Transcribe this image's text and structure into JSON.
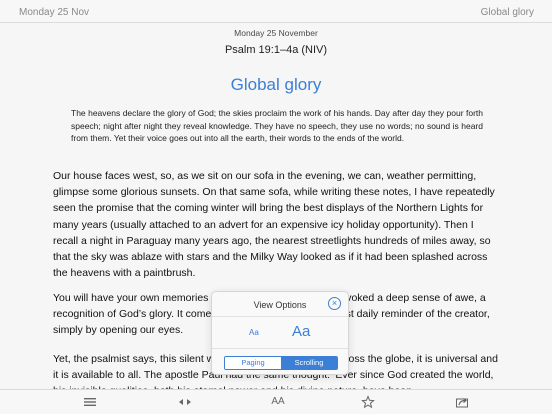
{
  "topbar": {
    "date_label": "Monday 25 Nov",
    "right_label": "Global glory"
  },
  "reading": {
    "date": "Monday 25 November",
    "reference": "Psalm 19:1–4a (NIV)",
    "title": "Global glory",
    "scripture": "The heavens declare the glory of God; the skies proclaim the work of his hands. Day after day they pour forth speech; night after night they reveal knowledge. They have no speech, they use no words; no sound is heard from them. Yet their voice goes out into all the earth, their words to the ends of the world.",
    "paragraphs": [
      "Our house faces west, so, as we sit on our sofa in the evening, we can, weather permitting, glimpse some glorious sunsets. On that same sofa, while writing these notes, I have repeatedly seen the promise that the coming winter will bring the best displays of the Northern Lights for many years (usually attached to an advert for an expensive icy holiday opportunity). Then I recall a night in Paraguay many years ago, the nearest streetlights hundreds of miles away, so that the sky was ablaze with stars and the Milky Way looked as if it had been splashed across the heavens with a paintbrush.",
      "You will have your own memories of when the heavens has provoked a deep sense of awe, a recognition of God’s glory. It comes to us, but it can be an almost daily reminder of the creator, simply by opening our eyes.",
      "Yet, the psalmist says, this silent witness is able to be heard across the globe, it is universal and it is available to all. The apostle Paul had the same thought: ‘Ever since God created the world, his invisible qualities, both his eternal power and his divine nature, have been"
    ]
  },
  "view_options": {
    "title": "View Options",
    "close_icon": "close-icon",
    "font_small_label": "Aa",
    "font_large_label": "Aa",
    "paging_label": "Paging",
    "scrolling_label": "Scrolling",
    "selected_mode": "Scrolling",
    "accent_color": "#3b7fd6"
  },
  "toolbar": {
    "font_label": "AA",
    "icons": [
      "list-icon",
      "prev-next-icon",
      "font-size-icon",
      "star-icon",
      "share-icon"
    ]
  }
}
